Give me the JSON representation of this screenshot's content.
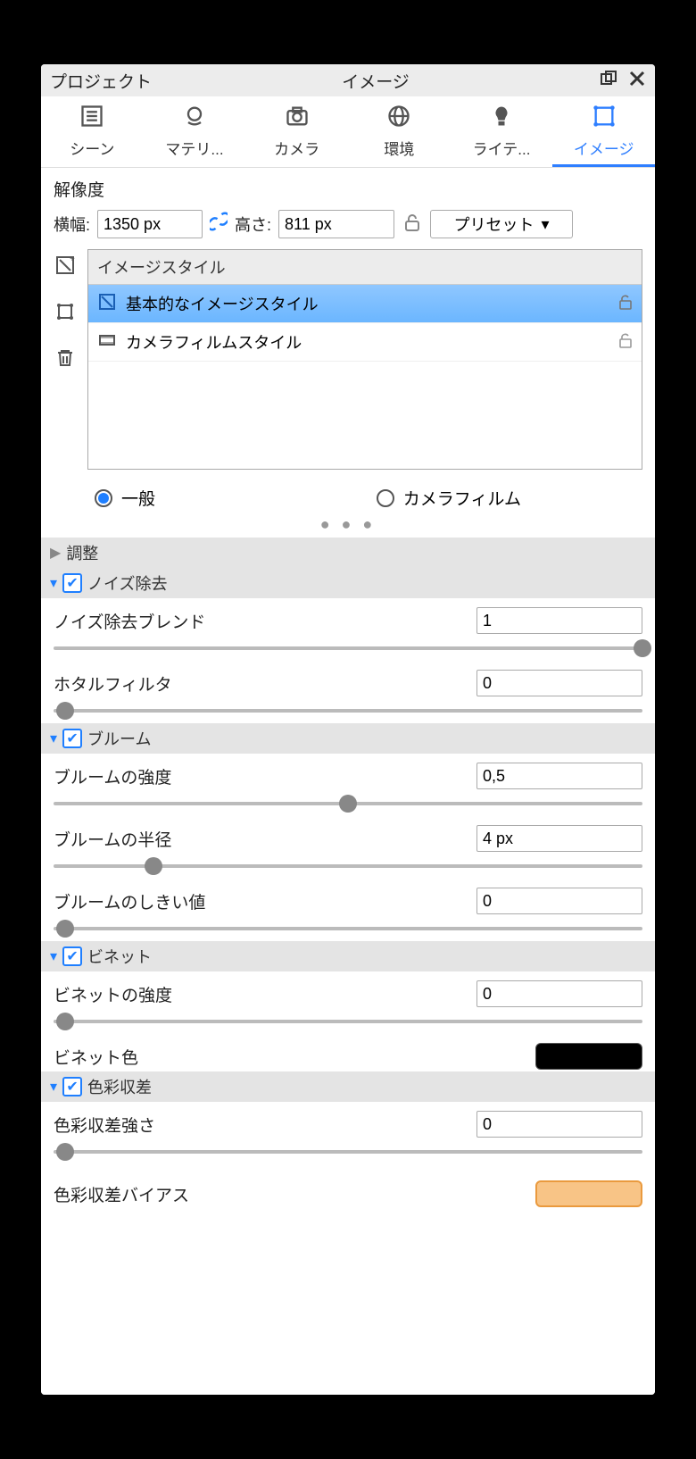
{
  "titlebar": {
    "project": "プロジェクト",
    "title": "イメージ"
  },
  "tabs": [
    {
      "label": "シーン"
    },
    {
      "label": "マテリ..."
    },
    {
      "label": "カメラ"
    },
    {
      "label": "環境"
    },
    {
      "label": "ライテ..."
    },
    {
      "label": "イメージ"
    }
  ],
  "resolution": {
    "title": "解像度",
    "width_label": "横幅:",
    "width_value": "1350 px",
    "height_label": "高さ:",
    "height_value": "811 px",
    "preset_label": "プリセット"
  },
  "styles": {
    "header": "イメージスタイル",
    "rows": [
      {
        "label": "基本的なイメージスタイル"
      },
      {
        "label": "カメラフィルムスタイル"
      }
    ]
  },
  "radios": {
    "general": "一般",
    "camera_film": "カメラフィルム"
  },
  "groups": {
    "adjust": "調整",
    "noise": "ノイズ除去",
    "bloom": "ブルーム",
    "vignette": "ビネット",
    "chroma": "色彩収差"
  },
  "params": {
    "noise_blend": {
      "label": "ノイズ除去ブレンド",
      "value": "1",
      "pct": 100
    },
    "firefly": {
      "label": "ホタルフィルタ",
      "value": "0",
      "pct": 2
    },
    "bloom_strength": {
      "label": "ブルームの強度",
      "value": "0,5",
      "pct": 50
    },
    "bloom_radius": {
      "label": "ブルームの半径",
      "value": "4 px",
      "pct": 17
    },
    "bloom_threshold": {
      "label": "ブルームのしきい値",
      "value": "0",
      "pct": 2
    },
    "vignette_strength": {
      "label": "ビネットの強度",
      "value": "0",
      "pct": 2
    },
    "vignette_color": {
      "label": "ビネット色"
    },
    "chroma_strength": {
      "label": "色彩収差強さ",
      "value": "0",
      "pct": 2
    },
    "chroma_bias": {
      "label": "色彩収差バイアス"
    }
  }
}
